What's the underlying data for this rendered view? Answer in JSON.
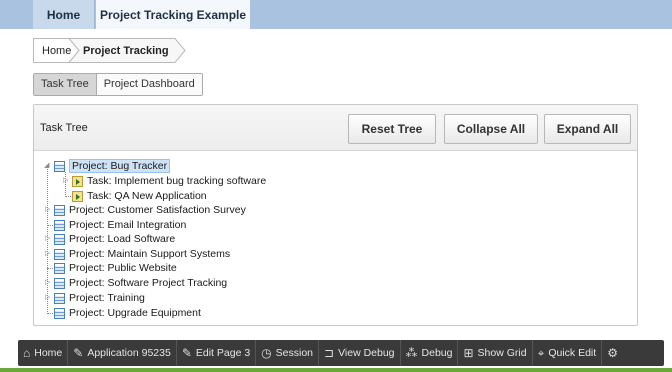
{
  "top_tabs": [
    {
      "label": "Home"
    },
    {
      "label": "Project Tracking Example"
    }
  ],
  "breadcrumb": {
    "items": [
      "Home",
      "Project Tracking"
    ]
  },
  "region_switcher": {
    "buttons": [
      "Task Tree",
      "Project Dashboard"
    ],
    "selected": "Task Tree"
  },
  "task_tree_region": {
    "title": "Task Tree",
    "buttons": {
      "reset": "Reset Tree",
      "collapse": "Collapse All",
      "expand": "Expand All"
    },
    "nodes": [
      {
        "label": "Project: Bug Tracker",
        "type": "project",
        "level": 0,
        "selected": true,
        "expanded": true
      },
      {
        "label": "Task: Implement bug tracking software",
        "type": "task",
        "level": 1
      },
      {
        "label": "Task: QA New Application",
        "type": "task",
        "level": 1
      },
      {
        "label": "Project: Customer Satisfaction Survey",
        "type": "project",
        "level": 0
      },
      {
        "label": "Project: Email Integration",
        "type": "project",
        "level": 0
      },
      {
        "label": "Project: Load Software",
        "type": "project",
        "level": 0
      },
      {
        "label": "Project: Maintain Support Systems",
        "type": "project",
        "level": 0
      },
      {
        "label": "Project: Public Website",
        "type": "project",
        "level": 0
      },
      {
        "label": "Project: Software Project Tracking",
        "type": "project",
        "level": 0
      },
      {
        "label": "Project: Training",
        "type": "project",
        "level": 0
      },
      {
        "label": "Project: Upgrade Equipment",
        "type": "project",
        "level": 0
      }
    ]
  },
  "developer_toolbar": {
    "items": [
      {
        "label": "Home",
        "icon": "home-icon"
      },
      {
        "label": "Application 95235",
        "icon": "edit-app-icon"
      },
      {
        "label": "Edit Page 3",
        "icon": "edit-page-icon"
      },
      {
        "label": "Session",
        "icon": "clock-icon"
      },
      {
        "label": "View Debug",
        "icon": "view-debug-icon"
      },
      {
        "label": "Debug",
        "icon": "debug-icon"
      },
      {
        "label": "Show Grid",
        "icon": "grid-icon"
      },
      {
        "label": "Quick Edit",
        "icon": "quick-edit-icon"
      },
      {
        "label": "",
        "icon": "gear-icon"
      }
    ]
  },
  "colors": {
    "top_bar": "#a8c2e0",
    "selected_node": "#cfe3f7",
    "dev_toolbar": "#3a3a3a",
    "accent_green": "#6aa83c"
  }
}
